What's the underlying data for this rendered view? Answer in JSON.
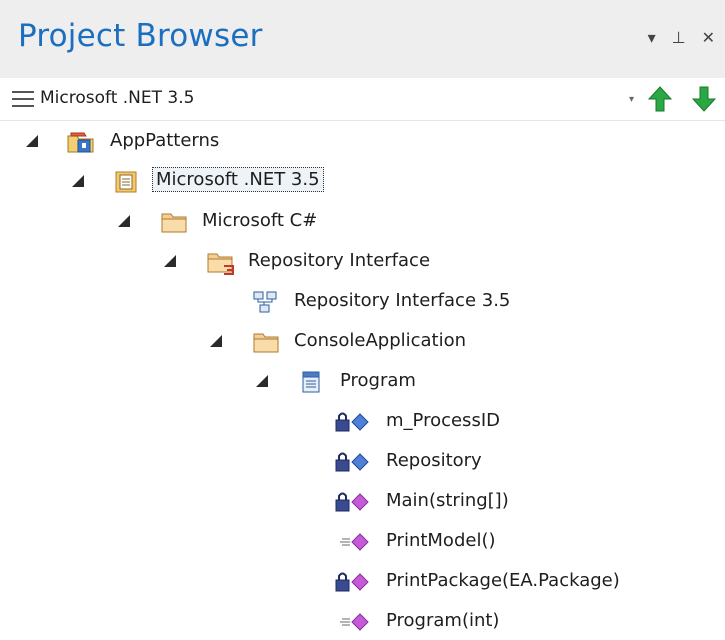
{
  "panel": {
    "title": "Project Browser",
    "actions": [
      {
        "icon": "dropdown-arrow-icon",
        "glyph": "▾"
      },
      {
        "icon": "pin-icon",
        "glyph": "⊥"
      },
      {
        "icon": "close-icon",
        "glyph": "✕"
      }
    ]
  },
  "toolbar": {
    "selector_label": "Microsoft .NET 3.5",
    "dropdown_glyph": "▾"
  },
  "tree": {
    "nodes": [
      {
        "label": "AppPatterns"
      },
      {
        "label": "Microsoft .NET 3.5"
      },
      {
        "label": "Microsoft C#"
      },
      {
        "label": "Repository Interface"
      },
      {
        "label": "Repository Interface 3.5"
      },
      {
        "label": "ConsoleApplication"
      },
      {
        "label": "Program"
      },
      {
        "label": "m_ProcessID"
      },
      {
        "label": "Repository"
      },
      {
        "label": "Main(string[])"
      },
      {
        "label": "PrintModel()"
      },
      {
        "label": "PrintPackage(EA.Package)"
      },
      {
        "label": "Program(int)"
      }
    ]
  }
}
